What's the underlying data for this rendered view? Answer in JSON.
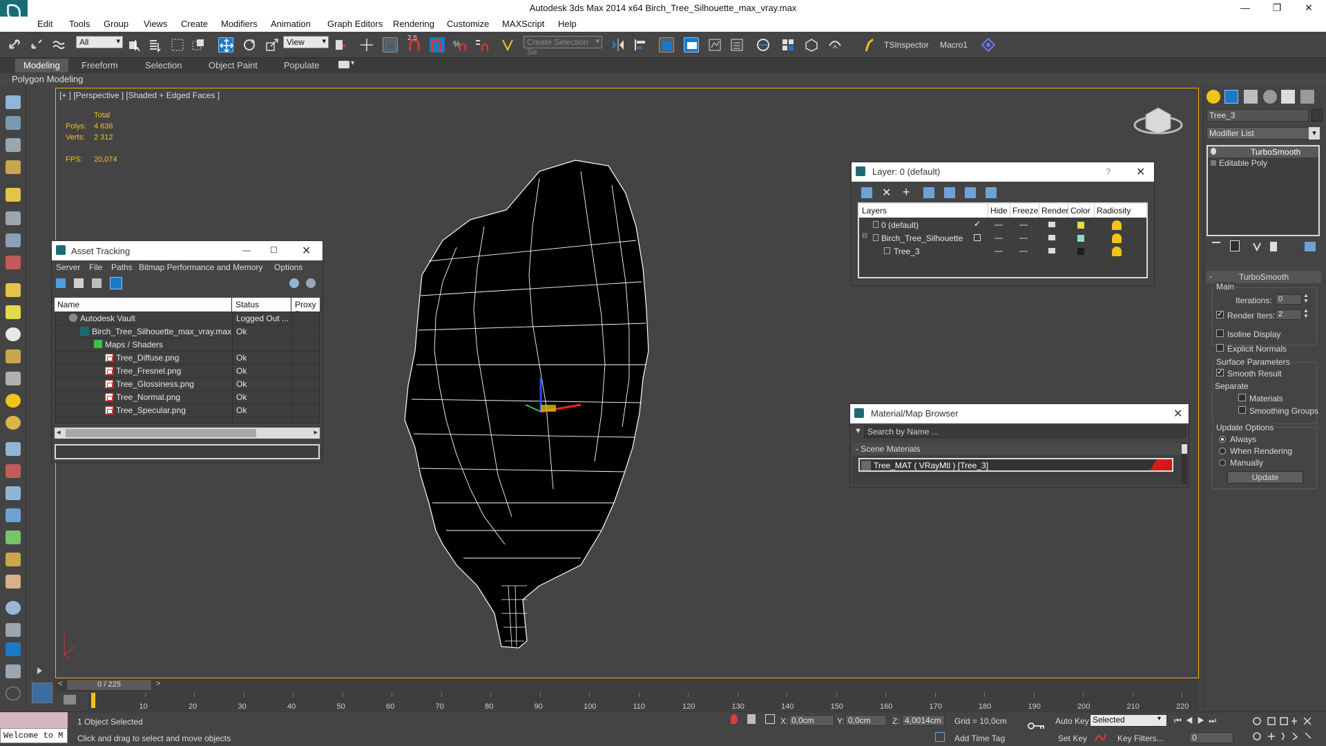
{
  "window": {
    "title": "Autodesk 3ds Max  2014 x64    Birch_Tree_Silhouette_max_vray.max",
    "minimize_glyph": "—",
    "maximize_glyph": "❐",
    "close_glyph": "✕"
  },
  "menu": [
    "Edit",
    "Tools",
    "Group",
    "Views",
    "Create",
    "Modifiers",
    "Animation",
    "Graph Editors",
    "Rendering",
    "Customize",
    "MAXScript",
    "Help"
  ],
  "toolbar": {
    "selection_filter": "All",
    "reference_coord": "View",
    "snap_label": "2.5",
    "named_selection_placeholder": "Create Selection Se",
    "tsinspector": "TSInspector",
    "macro1": "Macro1"
  },
  "ribbon": {
    "tabs": [
      "Modeling",
      "Freeform",
      "Selection",
      "Object Paint",
      "Populate"
    ],
    "active_tab": "Modeling",
    "sub_label": "Polygon Modeling"
  },
  "viewport": {
    "label": "[+ ] [Perspective ] [Shaded + Edged Faces ]",
    "stats_total": "Total",
    "polys_label": "Polys:",
    "polys_value": "4 636",
    "verts_label": "Verts:",
    "verts_value": "2 312",
    "fps_label": "FPS:",
    "fps_value": "20,074"
  },
  "asset_tracking": {
    "title": "Asset Tracking",
    "menu": [
      "Server",
      "File",
      "Paths",
      "Bitmap Performance and Memory",
      "Options"
    ],
    "columns": [
      "Name",
      "Status",
      "Proxy R"
    ],
    "rows": [
      {
        "name": "Autodesk Vault",
        "status": "Logged Out ..."
      },
      {
        "name": "Birch_Tree_Silhouette_max_vray.max",
        "status": "Ok"
      },
      {
        "name": "Maps / Shaders",
        "status": ""
      },
      {
        "name": "Tree_Diffuse.png",
        "status": "Ok"
      },
      {
        "name": "Tree_Fresnel.png",
        "status": "Ok"
      },
      {
        "name": "Tree_Glossiness.png",
        "status": "Ok"
      },
      {
        "name": "Tree_Normal.png",
        "status": "Ok"
      },
      {
        "name": "Tree_Specular.png",
        "status": "Ok"
      }
    ]
  },
  "layer_panel": {
    "title": "Layer: 0 (default)",
    "help": "?",
    "columns": [
      "Layers",
      "Hide",
      "Freeze",
      "Render",
      "Color",
      "Radiosity"
    ],
    "rows": [
      {
        "name": "0 (default)",
        "color": "#e3d94a"
      },
      {
        "name": "Birch_Tree_Silhouette",
        "color": "#8fd9c9"
      },
      {
        "name": "Tree_3",
        "color": "#1e1e1e"
      }
    ]
  },
  "material_browser": {
    "title": "Material/Map Browser",
    "search_placeholder": "Search by Name ...",
    "section": "- Scene Materials",
    "material": "Tree_MAT ( VRayMtl ) [Tree_3]"
  },
  "command_panel": {
    "object_name": "Tree_3",
    "modifier_list": "Modifier List",
    "stack": [
      "TurboSmooth",
      "Editable Poly"
    ],
    "rollout_title": "TurboSmooth",
    "main_group": "Main",
    "iterations_label": "Iterations:",
    "iterations_value": "0",
    "render_iters_label": "Render Iters:",
    "render_iters_value": "2",
    "isoline": "Isoline Display",
    "explicit_normals": "Explicit Normals",
    "surface_params": "Surface Parameters",
    "smooth_result": "Smooth Result",
    "separate": "Separate",
    "materials": "Materials",
    "smoothing_groups": "Smoothing Groups",
    "update_options": "Update Options",
    "always": "Always",
    "when_rendering": "When Rendering",
    "manually": "Manually",
    "update_button": "Update"
  },
  "timeline": {
    "frame_counter": "0 / 225",
    "ticks": [
      10,
      20,
      30,
      40,
      50,
      60,
      70,
      80,
      90,
      100,
      110,
      120,
      130,
      140,
      150,
      160,
      170,
      180,
      190,
      200,
      210,
      220
    ]
  },
  "status": {
    "welcome": "Welcome to M",
    "selected": "1 Object Selected",
    "hint": "Click and drag to select and move objects",
    "x_label": "X:",
    "x_value": "0,0cm",
    "y_label": "Y:",
    "y_value": "0,0cm",
    "z_label": "Z:",
    "z_value": "4,0014cm",
    "grid": "Grid = 10,0cm",
    "add_time_tag": "Add Time Tag",
    "auto_key": "Auto Key",
    "set_key": "Set Key",
    "selected_dropdown": "Selected",
    "key_filters": "Key Filters...",
    "frame_value": "0"
  }
}
